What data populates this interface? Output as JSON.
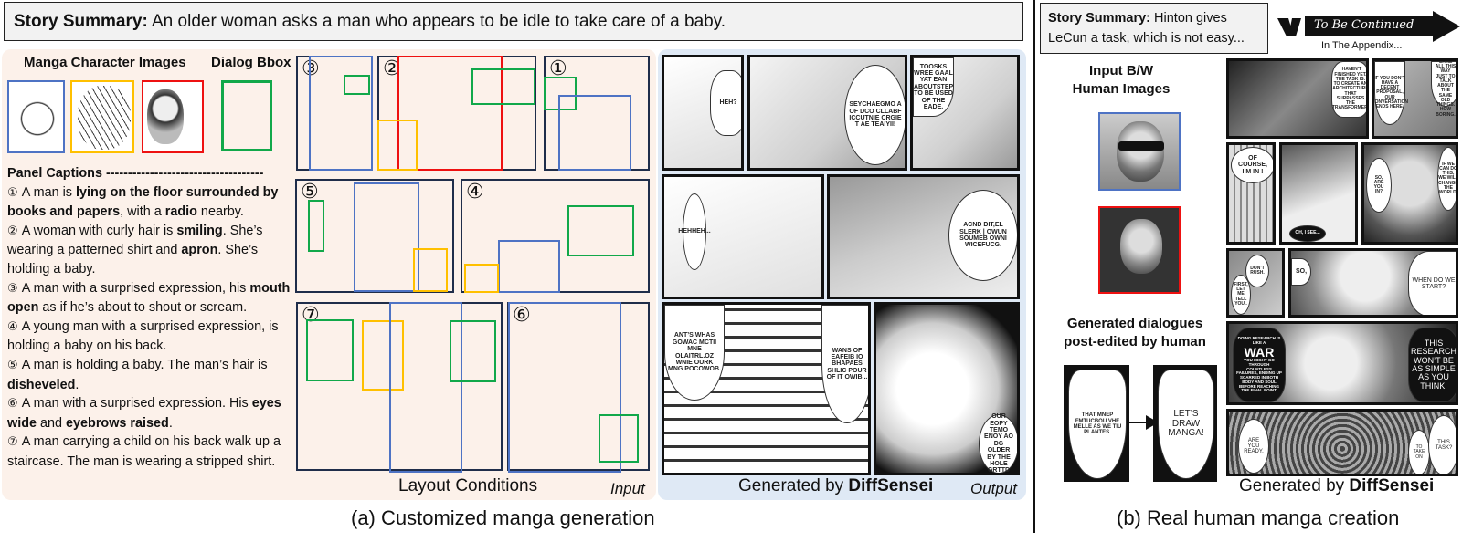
{
  "part_a": {
    "summary_label": "Story Summary:",
    "summary_text": " An older woman asks a man who appears to be idle to take care of a baby.",
    "character_images_header": "Manga Character Images",
    "dialog_bbox_header": "Dialog Bbox",
    "character_colors": [
      "#4e73c4",
      "#ffc000",
      "#ee1111"
    ],
    "dialog_bbox_color": "#11a84a",
    "captions_header": "Panel Captions ------------------------------------",
    "captions": [
      {
        "num": "①",
        "parts": [
          [
            "A man is ",
            false
          ],
          [
            "lying on the floor surrounded by books and papers",
            true
          ],
          [
            ", with a ",
            false
          ],
          [
            "radio",
            true
          ],
          [
            " nearby.",
            false
          ]
        ]
      },
      {
        "num": "②",
        "parts": [
          [
            "A woman with curly hair is ",
            false
          ],
          [
            "smiling",
            true
          ],
          [
            ". She’s wearing a patterned shirt and ",
            false
          ],
          [
            "apron",
            true
          ],
          [
            ". She’s holding a baby.",
            false
          ]
        ]
      },
      {
        "num": "③",
        "parts": [
          [
            "A man with a surprised expression, his ",
            false
          ],
          [
            "mouth open",
            true
          ],
          [
            " as if he’s about to shout or scream.",
            false
          ]
        ]
      },
      {
        "num": "④",
        "parts": [
          [
            "A young man with a surprised expression, is holding a baby on his back.",
            false
          ]
        ]
      },
      {
        "num": "⑤",
        "parts": [
          [
            "A man is holding a baby. The man’s hair is ",
            false
          ],
          [
            "disheveled",
            true
          ],
          [
            ".",
            false
          ]
        ]
      },
      {
        "num": "⑥",
        "parts": [
          [
            "A man with a surprised expression. His ",
            false
          ],
          [
            "eyes wide",
            true
          ],
          [
            " and ",
            false
          ],
          [
            "eyebrows raised",
            true
          ],
          [
            ".",
            false
          ]
        ]
      },
      {
        "num": "⑦",
        "parts": [
          [
            "A man carrying a child on his back walk up a staircase. The man is wearing a stripped shirt.",
            false
          ]
        ]
      }
    ],
    "layout_panel_numbers": [
      "③",
      "②",
      "①",
      "⑤",
      "④",
      "⑦",
      "⑥"
    ],
    "layout_label": "Layout Conditions",
    "input_label": "Input",
    "output_label_prefix": "Generated by ",
    "output_label_bold": "DiffSensei",
    "output_tag": "Output",
    "generated_dialogues": [
      "HEH?",
      "SEYCHAEGMO A OF DCO CLLABF ICCUTNIE CRGIE T AE TEAIYII!",
      "TOOSKS WREE GAAL YAT EAN ABOUTSTEP TO BE USED OF THE EADE.",
      "HEHHEH...",
      "ACND DIT,EL SLERK | OWUN SOUMEB OWNI WICEFUCG.",
      "ANT’S WHAS GOWAC MCTII MNE OLAITRL.OZ WNIE OURK MNG POCOWOB.",
      "WANS OF EAFEIB IO BHAPAES SHLIC POUR OF IT OWIB...",
      "OUR EOPY TEMO ENOY AO DG OLDER BY THE HOLE GRTTD"
    ],
    "figure_caption": "(a) Customized manga generation"
  },
  "part_b": {
    "summary_label": "Story Summary:",
    "summary_text": " Hinton gives LeCun a task, which is not easy...",
    "to_be_continued": "To Be Continued",
    "appendix_note": "In The Appendix...",
    "input_header": "Input B/W Human Images",
    "human_image_colors": [
      "#4e73c4",
      "#ee1111"
    ],
    "dialogues_header": "Generated dialogues post-edited by human",
    "before_dialogue": "THAT MNEP FMTUCBOU VHE MELLE AS WE TIU PLANTES.",
    "after_dialogue": "LET’S DRAW MANGA!",
    "manga_dialogues": [
      "I HAVEN’T FINISHED YET. THE TASK IS: TO CREATE AN ARCHITECTURE THAT SURPASSES THE TRANSFORMER.",
      "IF YOU DON’T HAVE A DECENT PROPOSAL, OUR CONVERSATION ENDS HERE.",
      "HAHA, YOU CAME ALL THIS WAY JUST TO TALK ABOUT THE SAME OLD THINGS. HOW BORING.",
      "OF COURSE, I’M IN !",
      "OH, I SEE...",
      "SO, ARE YOU IN?",
      "IF WE CAN DO THIS, WE WILL CHANGE THE WORLD.",
      "DON’T RUSH.",
      "FIRST, LET ME TELL YOU..",
      "SO,",
      "WHEN DO WE START?",
      "DOING RESEARCH IS LIKE A",
      "WAR",
      "YOU MIGHT GO THROUGH COUNTLESS FAILURES, ENDING UP SCARRED IN BOTH BODY AND SOUL BEFORE REACHING THE FINAL POINT.",
      "THIS RESEARCH WON’T BE AS SIMPLE AS YOU THINK.",
      "ARE YOU READY,",
      "TO TAKE ON",
      "THIS TASK?"
    ],
    "output_label_prefix": "Generated by ",
    "output_label_bold": "DiffSensei",
    "figure_caption": "(b) Real human manga creation"
  }
}
